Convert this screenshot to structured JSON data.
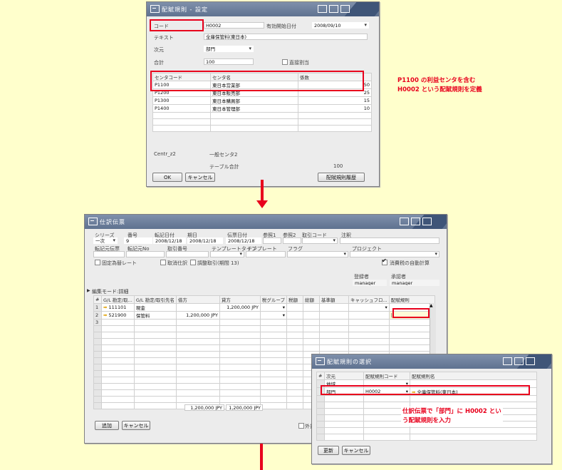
{
  "colors": {
    "accent_red": "#E8001C",
    "background": "#FFFFCC",
    "titlebar": "#6A7D9B"
  },
  "dialog1": {
    "title": "配賦規則 - 設定",
    "code_label": "コード",
    "code_value": "H0002",
    "valid_from_label": "有効開始日付",
    "valid_from_value": "2008/09/10",
    "text_label": "テキスト",
    "text_value": "全庫保管料(東日本)",
    "dimension_label": "次元",
    "dimension_value": "部門",
    "total_label": "合計",
    "total_value": "100",
    "direct_alloc_label": "直接割当",
    "columns": [
      "センタコード",
      "センタ名",
      "係数"
    ],
    "rows": [
      {
        "code": "P1100",
        "name": "東日本営業部",
        "factor": "50"
      },
      {
        "code": "P1200",
        "name": "東日本販売部",
        "factor": "25"
      },
      {
        "code": "P1300",
        "name": "東日本購買部",
        "factor": "15"
      },
      {
        "code": "P1400",
        "name": "東日本管理部",
        "factor": "10"
      }
    ],
    "centr_label": "Centr_z2",
    "centr_value": "一般センタ2",
    "table_total_label": "テーブル合計",
    "table_total_value": "100",
    "ok_label": "OK",
    "cancel_label": "キャンセル",
    "history_label": "配賦規則履歴"
  },
  "note1": {
    "line1": "P1100 の利益センタを含む",
    "line2": "H0002 という配賦規則を定義"
  },
  "journal": {
    "title": "仕訳伝票",
    "series_label": "シリーズ",
    "number_label": "番号",
    "posting_date_label": "転記日付",
    "due_date_label": "期日",
    "doc_date_label": "伝票日付",
    "ref1_label": "参照1",
    "ref2_label": "参照2",
    "trans_code_label": "取引コード",
    "remarks_label": "注釈",
    "series_value": "一次",
    "number_value": "9",
    "posting_date_value": "2008/12/18",
    "due_date_value": "2008/12/18",
    "doc_date_value": "2008/12/18",
    "origin_label": "転記元伝票",
    "origin_no_label": "転記元No",
    "trans_no_label": "取引番号",
    "template_type_label": "テンプレートタイプ",
    "template_label": "テンプレート",
    "flag_label": "フラグ",
    "project_label": "プロジェクト",
    "fixed_rate_label": "固定為替レート",
    "reverse_label": "取消仕訳",
    "adjust_label": "調整取引(期間 13)",
    "auto_tax_label": "消費税の自動計算",
    "creator_label": "登録者",
    "approver_label": "承認者",
    "creator_value": "manager",
    "approver_value": "manager",
    "edit_mode_label": "編集モード:詳細",
    "columns": [
      "#",
      "G/L 勘定/取...",
      "G/L 勘定/取引先名",
      "借方",
      "貸方",
      "税グループ",
      "税額",
      "総額",
      "基準額",
      "キャッシュフロ...",
      "配賦規則"
    ],
    "rows": [
      {
        "no": "1",
        "account": "111101",
        "name": "現金",
        "debit": "",
        "credit": "1,200,000 JPY"
      },
      {
        "no": "2",
        "account": "521900",
        "name": "保管料",
        "debit": "1,200,000 JPY",
        "credit": ""
      },
      {
        "no": "3",
        "account": "",
        "name": "",
        "debit": "",
        "credit": ""
      }
    ],
    "total_debit": "1,200,000 JPY",
    "total_credit": "1,200,000 JPY",
    "add_label": "追加",
    "cancel_label": "キャンセル",
    "foreign_label": "外貨"
  },
  "select_dialog": {
    "title": "配賦規則の選択",
    "columns": [
      "#",
      "次元",
      "配賦規則コード",
      "配賦規則名"
    ],
    "rows": [
      {
        "dimension": "地域",
        "code": "",
        "name": ""
      },
      {
        "dimension": "部門",
        "code": "H0002",
        "name": "全庫保管料(東日本)"
      }
    ],
    "update_label": "更新",
    "cancel_label": "キャンセル"
  },
  "note2": {
    "line1": "仕訳伝票で「部門」に H0002 とい",
    "line2": "う配賦規則を入力"
  }
}
